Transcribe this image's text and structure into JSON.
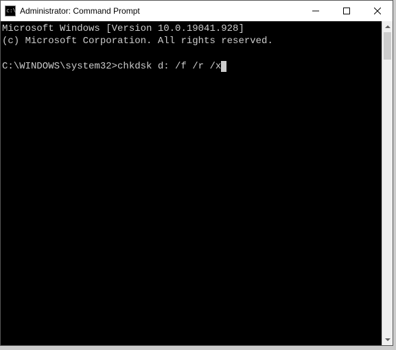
{
  "titlebar": {
    "icon_text": "c:\\",
    "title": "Administrator: Command Prompt"
  },
  "terminal": {
    "line1": "Microsoft Windows [Version 10.0.19041.928]",
    "line2": "(c) Microsoft Corporation. All rights reserved.",
    "blank": "",
    "prompt": "C:\\WINDOWS\\system32>",
    "command": "chkdsk d: /f /r /x"
  }
}
